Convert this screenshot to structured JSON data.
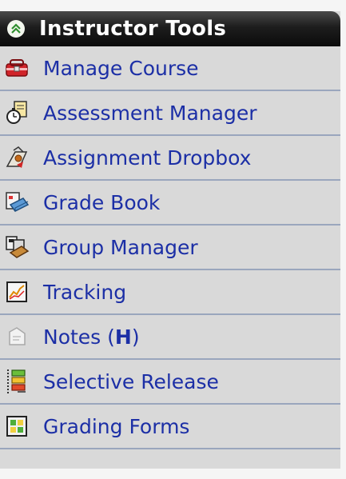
{
  "panel": {
    "title": "Instructor Tools",
    "collapse_icon": "double-chevron-up-icon"
  },
  "menu": [
    {
      "label": "Manage Course",
      "icon": "toolbox-icon"
    },
    {
      "label": "Assessment Manager",
      "icon": "stopwatch-document-icon"
    },
    {
      "label": "Assignment Dropbox",
      "icon": "dropbox-icon"
    },
    {
      "label": "Grade Book",
      "icon": "gradebook-icon"
    },
    {
      "label": "Group Manager",
      "icon": "group-books-icon"
    },
    {
      "label": "Tracking",
      "icon": "line-chart-icon"
    },
    {
      "label": "Notes (",
      "label_bold": "H",
      "label_end": ")",
      "icon": "notes-icon"
    },
    {
      "label": "Selective Release",
      "icon": "selective-release-icon"
    },
    {
      "label": "Grading Forms",
      "icon": "grading-forms-icon"
    }
  ],
  "colors": {
    "link": "#1c2fa6",
    "panel_bg": "#d9d9d9",
    "divider": "#9aa6bd",
    "header_bg": "#1d1d1d"
  }
}
